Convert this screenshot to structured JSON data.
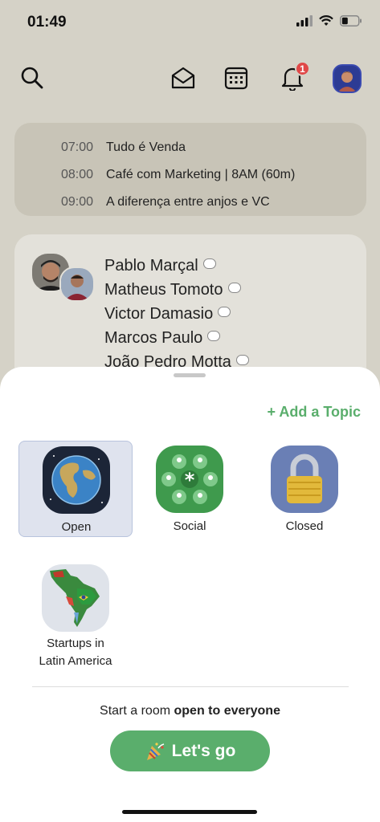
{
  "status_bar": {
    "time": "01:49"
  },
  "nav": {
    "notification_count": "1"
  },
  "schedule": [
    {
      "time": "07:00",
      "title": "Tudo é Venda"
    },
    {
      "time": "08:00",
      "title": "Café com Marketing | 8AM (60m)"
    },
    {
      "time": "09:00",
      "title": "A diferença entre anjos e VC"
    }
  ],
  "room_card": {
    "speakers": [
      "Pablo Marçal",
      "Matheus Tomoto",
      "Victor Damasio",
      "Marcos Paulo",
      "João Pedro Motta"
    ]
  },
  "sheet": {
    "add_topic": "+ Add a Topic",
    "room_types": [
      {
        "label": "Open",
        "icon": "globe-icon",
        "selected": true
      },
      {
        "label": "Social",
        "icon": "people-icon"
      },
      {
        "label": "Closed",
        "icon": "lock-icon"
      }
    ],
    "club": {
      "label_line1": "Startups in",
      "label_line2": "Latin America",
      "icon": "latin-america-map-icon"
    },
    "start_prefix": "Start a room ",
    "start_bold": "open to everyone",
    "go_button": "Let's go"
  },
  "colors": {
    "accent": "#5aae6c",
    "background": "#d5d2c7",
    "badge": "#e04848"
  }
}
